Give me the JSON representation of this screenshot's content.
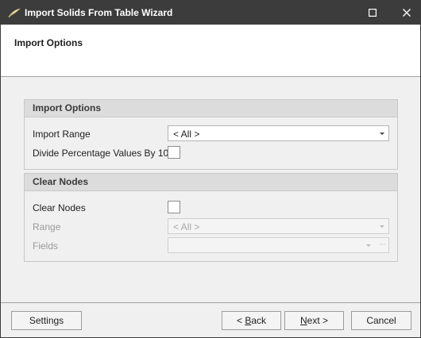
{
  "window": {
    "title": "Import Solids From Table Wizard",
    "icons": {
      "app": "feather-icon",
      "maximize": "maximize-icon",
      "close": "close-icon"
    }
  },
  "header": {
    "title": "Import Options"
  },
  "import_options": {
    "heading": "Import Options",
    "range_label": "Import Range",
    "range_value": "< All >",
    "divide_label": "Divide Percentage Values By 100",
    "divide_checked": false
  },
  "clear_nodes": {
    "heading": "Clear Nodes",
    "clear_label": "Clear Nodes",
    "clear_checked": false,
    "range_label": "Range",
    "range_value": "< All >",
    "fields_label": "Fields",
    "fields_value": "",
    "fields_button": "···"
  },
  "buttons": {
    "settings": "Settings",
    "back_prefix": "< ",
    "back_mnemonic": "B",
    "back_rest": "ack",
    "next_mnemonic": "N",
    "next_rest": "ext >",
    "cancel": "Cancel"
  },
  "colors": {
    "titlebar": "#3c3c3c",
    "group_header": "#dcdcdc",
    "background": "#f0f0f0"
  }
}
